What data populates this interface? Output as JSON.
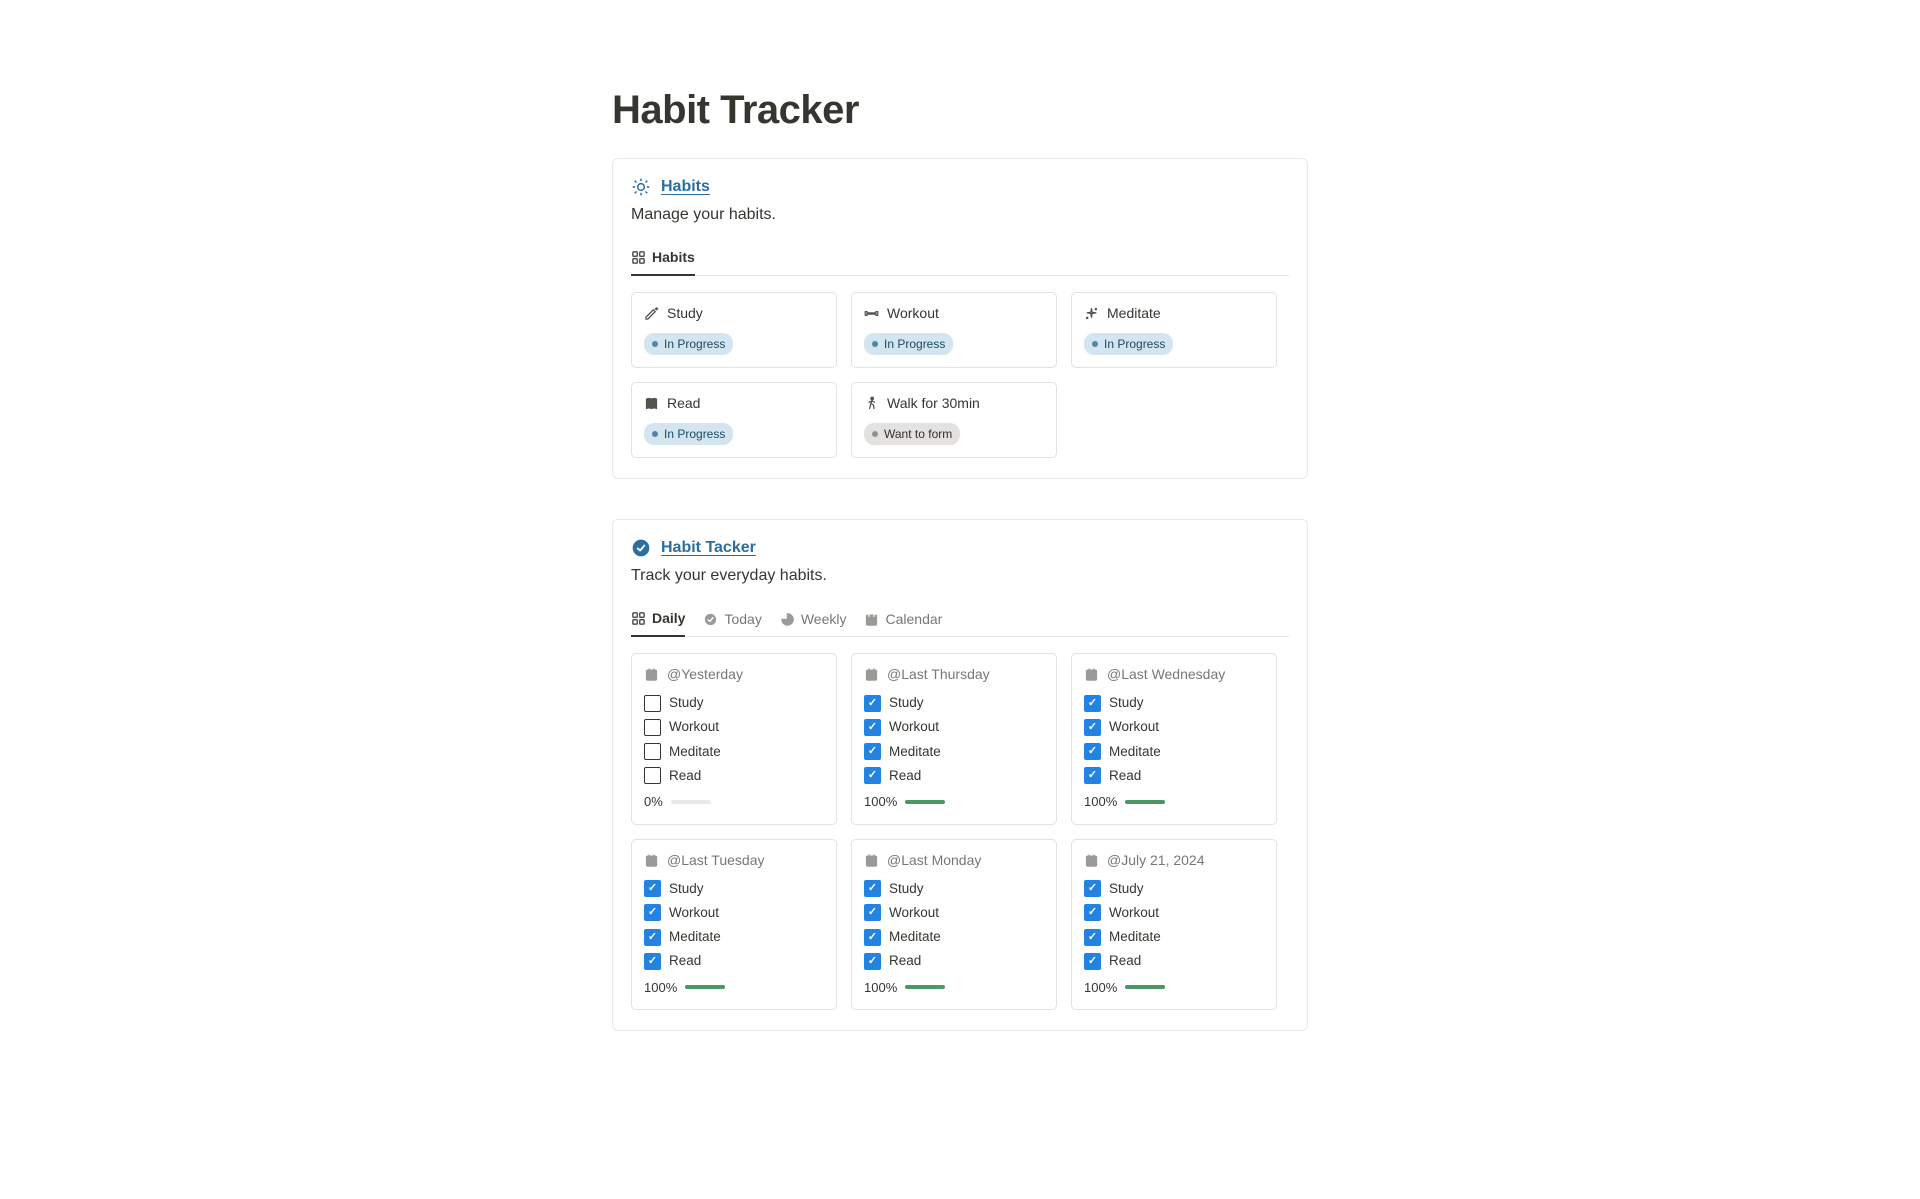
{
  "page": {
    "title": "Habit Tracker"
  },
  "habits_section": {
    "title": "Habits",
    "subtitle": "Manage your habits.",
    "view_label": "Habits",
    "cards": [
      {
        "title": "Study",
        "status": "In Progress",
        "status_style": "blue",
        "icon": "pencil"
      },
      {
        "title": "Workout",
        "status": "In Progress",
        "status_style": "blue",
        "icon": "dumbbell"
      },
      {
        "title": "Meditate",
        "status": "In Progress",
        "status_style": "blue",
        "icon": "sparkle"
      },
      {
        "title": "Read",
        "status": "In Progress",
        "status_style": "blue",
        "icon": "book"
      },
      {
        "title": "Walk for 30min",
        "status": "Want to form",
        "status_style": "gray",
        "icon": "walk"
      }
    ]
  },
  "tracker_section": {
    "title": "Habit Tacker",
    "subtitle": "Track your everyday habits.",
    "tabs": [
      {
        "label": "Daily",
        "icon": "grid",
        "active": true
      },
      {
        "label": "Today",
        "icon": "check",
        "active": false
      },
      {
        "label": "Weekly",
        "icon": "pie",
        "active": false
      },
      {
        "label": "Calendar",
        "icon": "calendar",
        "active": false
      }
    ],
    "habit_labels": [
      "Study",
      "Workout",
      "Meditate",
      "Read"
    ],
    "days": [
      {
        "date": "@Yesterday",
        "checks": [
          false,
          false,
          false,
          false
        ],
        "progress": 0
      },
      {
        "date": "@Last Thursday",
        "checks": [
          true,
          true,
          true,
          true
        ],
        "progress": 100
      },
      {
        "date": "@Last Wednesday",
        "checks": [
          true,
          true,
          true,
          true
        ],
        "progress": 100
      },
      {
        "date": "@Last Tuesday",
        "checks": [
          true,
          true,
          true,
          true
        ],
        "progress": 100
      },
      {
        "date": "@Last Monday",
        "checks": [
          true,
          true,
          true,
          true
        ],
        "progress": 100
      },
      {
        "date": "@July 21, 2024",
        "checks": [
          true,
          true,
          true,
          true
        ],
        "progress": 100
      }
    ]
  }
}
